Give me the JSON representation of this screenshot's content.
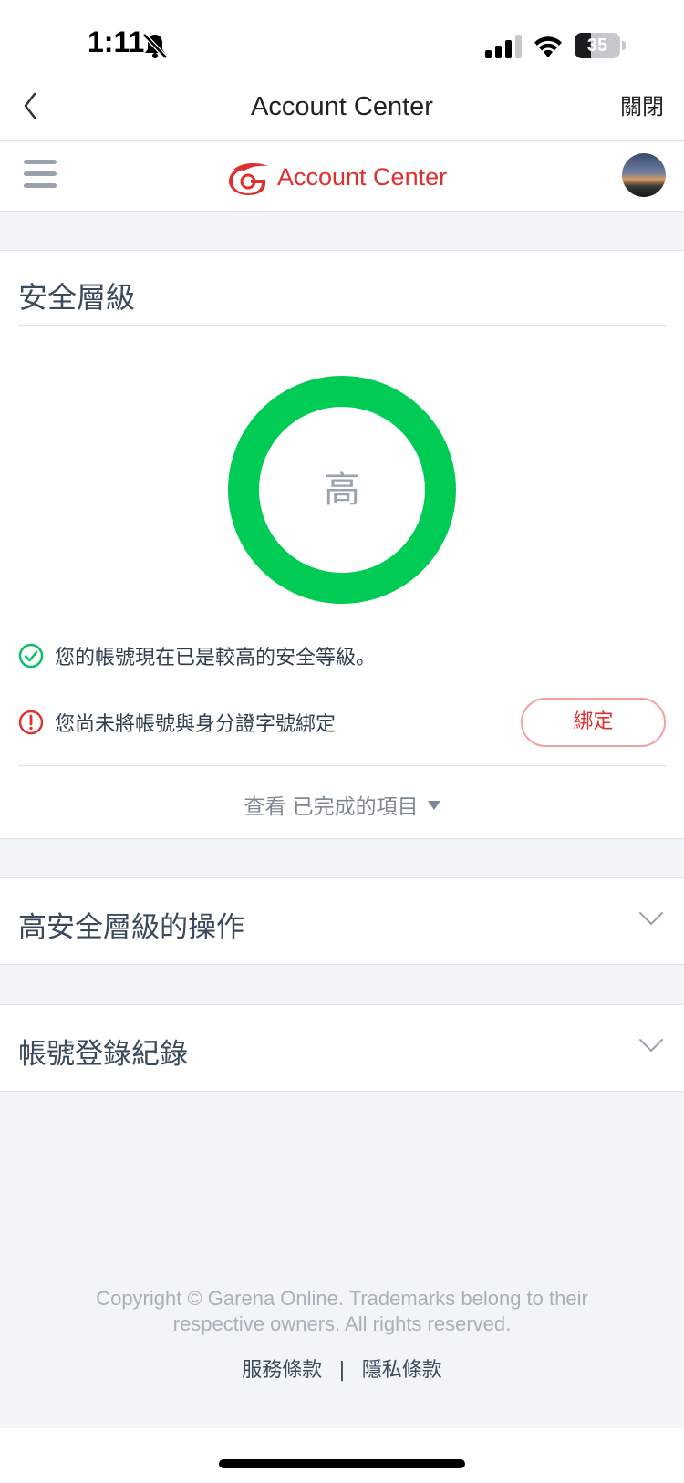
{
  "status_bar": {
    "time": "1:11",
    "battery_percent": 35,
    "battery_label": "35",
    "icons": [
      "bell-slash-icon",
      "cellular-signal-icon",
      "wifi-icon",
      "battery-icon"
    ]
  },
  "nav_bar": {
    "title": "Account Center",
    "close_label": "關閉"
  },
  "app_header": {
    "brand_text": "Account Center",
    "brand_color": "#e02f2f"
  },
  "security": {
    "title": "安全層級",
    "level_label": "高",
    "ring_color": "#00cc55",
    "ok_message": "您的帳號現在已是較高的安全等級。",
    "warning_message": "您尚未將帳號與身分證字號綁定",
    "bind_label": "綁定",
    "view_completed": "查看 已完成的項目"
  },
  "sections": [
    {
      "title": "高安全層級的操作"
    },
    {
      "title": "帳號登錄紀錄"
    }
  ],
  "footer": {
    "copyright": "Copyright © Garena Online. Trademarks belong to their respective owners. All rights reserved.",
    "terms_label": "服務條款",
    "separator": "|",
    "privacy_label": "隱私條款"
  }
}
